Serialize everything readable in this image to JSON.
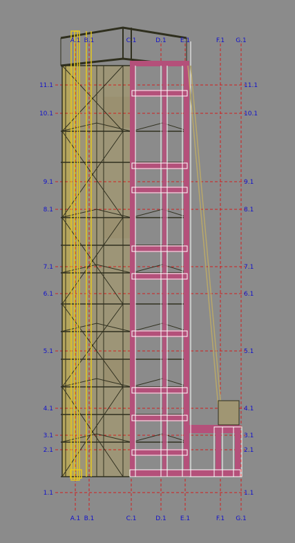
{
  "colors": {
    "background": "#8b8b8b",
    "grid_line": "#d21e1e",
    "label": "#1010cc",
    "steel_structure": "#2f2f1e",
    "yellow_column": "#e6c81e",
    "pink_member": "#b4507a",
    "white_outline": "#ffffff",
    "fill_panel": "#a09673"
  },
  "vertical_axes": [
    {
      "label": "A.1"
    },
    {
      "label": "B.1"
    },
    {
      "label": "C.1"
    },
    {
      "label": "D.1"
    },
    {
      "label": "E.1"
    },
    {
      "label": "F.1"
    },
    {
      "label": "G.1"
    }
  ],
  "horizontal_levels": [
    {
      "label": "11.1"
    },
    {
      "label": "10.1"
    },
    {
      "label": "9.1"
    },
    {
      "label": "8.1"
    },
    {
      "label": "7.1"
    },
    {
      "label": "6.1"
    },
    {
      "label": "5.1"
    },
    {
      "label": "4.1"
    },
    {
      "label": "3.1"
    },
    {
      "label": "2.1"
    },
    {
      "label": "1.1"
    }
  ]
}
